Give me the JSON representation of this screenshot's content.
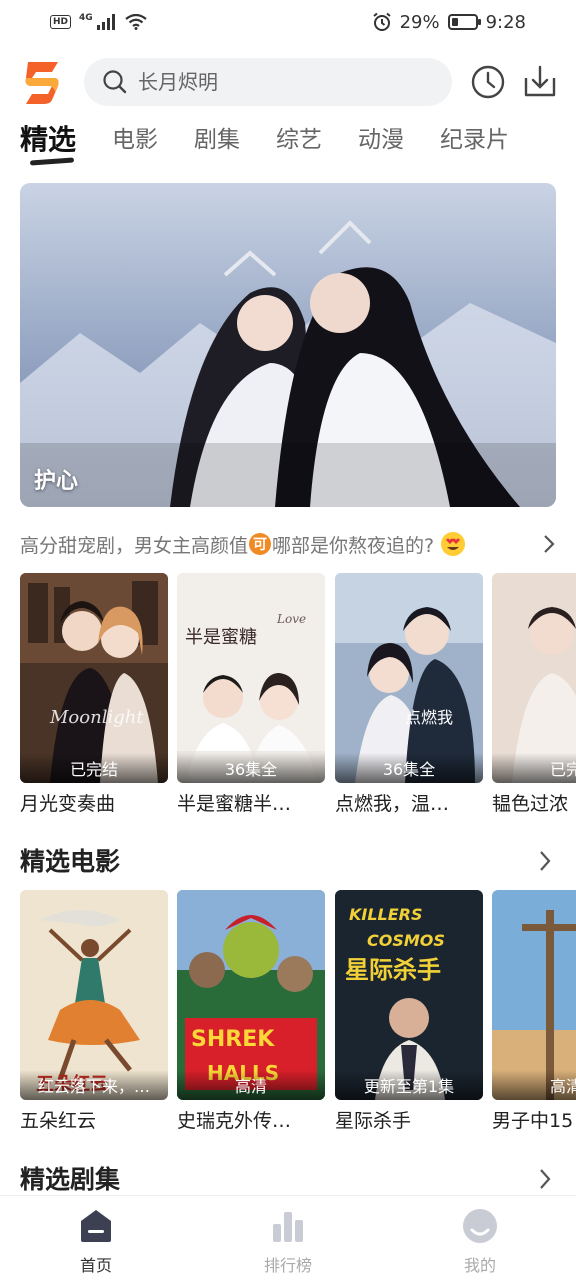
{
  "status_bar": {
    "hd": "HD",
    "network": "4G",
    "battery": "29%",
    "battery_level": 0.29,
    "time": "9:28"
  },
  "header": {
    "search_placeholder": "长月烬明",
    "icons": [
      "logo-icon",
      "search-icon",
      "history-icon",
      "download-icon"
    ]
  },
  "tabs": [
    {
      "label": "精选",
      "active": true
    },
    {
      "label": "电影",
      "active": false
    },
    {
      "label": "剧集",
      "active": false
    },
    {
      "label": "综艺",
      "active": false
    },
    {
      "label": "动漫",
      "active": false
    },
    {
      "label": "纪录片",
      "active": false
    }
  ],
  "banner": {
    "caption": "护心"
  },
  "recommend": {
    "text_before": "高分甜宠剧，男女主高颜值",
    "badge": "可",
    "text_after": "哪部是你熬夜追的?"
  },
  "row1": [
    {
      "title": "月光变奏曲",
      "badge": "已完结"
    },
    {
      "title": "半是蜜糖半…",
      "badge": "36集全"
    },
    {
      "title": "点燃我，温…",
      "badge": "36集全"
    },
    {
      "title": "韫色过浓",
      "badge": "已完"
    }
  ],
  "section_movies": {
    "title": "精选电影"
  },
  "row2": [
    {
      "title": "五朵红云",
      "badge": "红云落下来，…"
    },
    {
      "title": "史瑞克外传…",
      "badge": "高清"
    },
    {
      "title": "星际杀手",
      "badge": "更新至第1集"
    },
    {
      "title": "男子中15",
      "badge": "高清"
    }
  ],
  "section_series": {
    "title": "精选剧集"
  },
  "bottom_nav": [
    {
      "label": "首页",
      "active": true
    },
    {
      "label": "排行榜",
      "active": false
    },
    {
      "label": "我的",
      "active": false
    }
  ],
  "colors": {
    "brand_orange": "#f4622a",
    "badge_orange": "#f08a24"
  }
}
